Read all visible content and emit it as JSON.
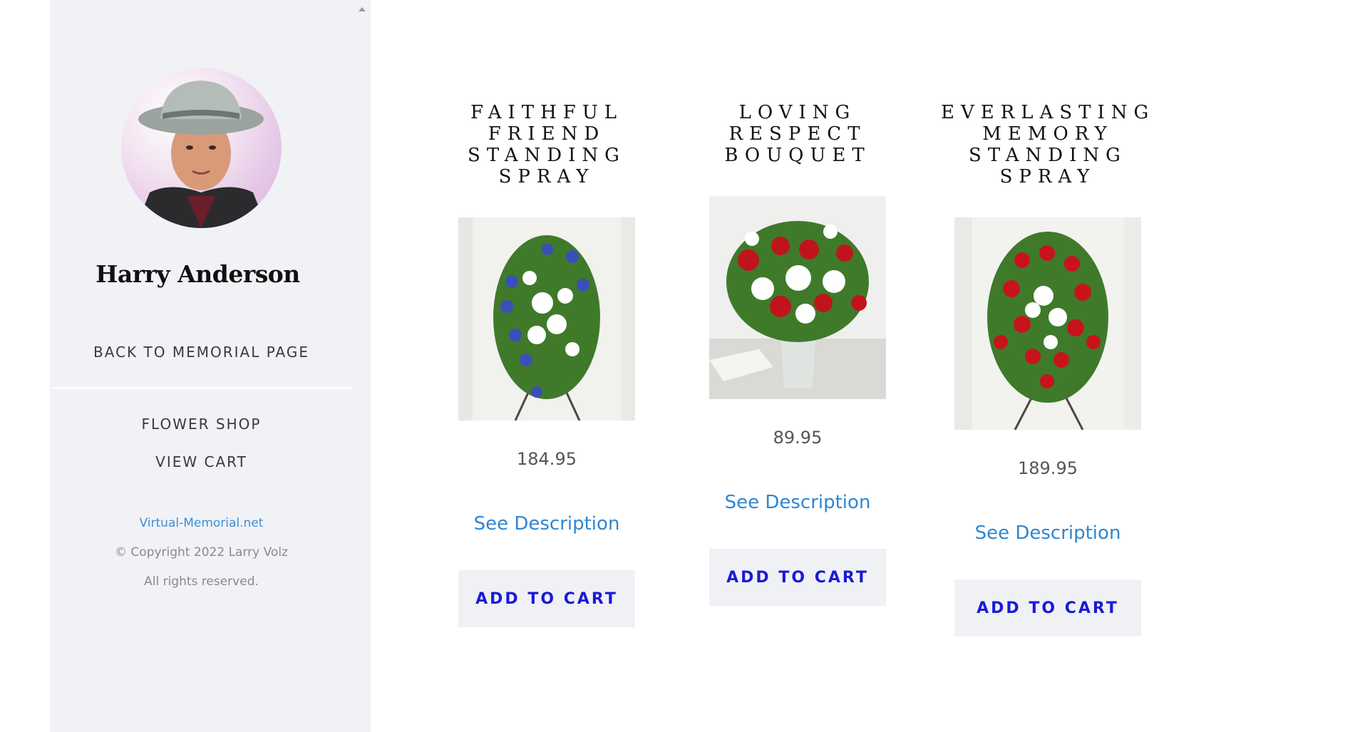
{
  "profile": {
    "name": "Harry Anderson"
  },
  "sidebar": {
    "back_link": "BACK TO MEMORIAL PAGE",
    "flower_shop": "FLOWER SHOP",
    "view_cart": "VIEW CART",
    "site_link": "Virtual-Memorial.net",
    "copyright": "© Copyright 2022 Larry Volz",
    "rights": "All rights reserved."
  },
  "products": [
    {
      "title": "FAITHFUL FRIEND STANDING SPRAY",
      "price": "184.95",
      "description_link": "See Description",
      "cart_label": "ADD TO CART",
      "flower_colors": [
        "#3b4fb8",
        "#ffffff",
        "#3f7a2a"
      ]
    },
    {
      "title": "LOVING RESPECT BOUQUET",
      "price": "89.95",
      "description_link": "See Description",
      "cart_label": "ADD TO CART",
      "flower_colors": [
        "#c0141c",
        "#ffffff",
        "#3f7a2a"
      ]
    },
    {
      "title": "EVERLASTING MEMORY STANDING SPRAY",
      "price": "189.95",
      "description_link": "See Description",
      "cart_label": "ADD TO CART",
      "flower_colors": [
        "#c8131d",
        "#ffffff",
        "#3f7a2a"
      ]
    }
  ],
  "colors": {
    "accent_link": "#2f86d0",
    "cart_text": "#1a1ad6",
    "sidebar_bg": "#f1f2f5"
  }
}
